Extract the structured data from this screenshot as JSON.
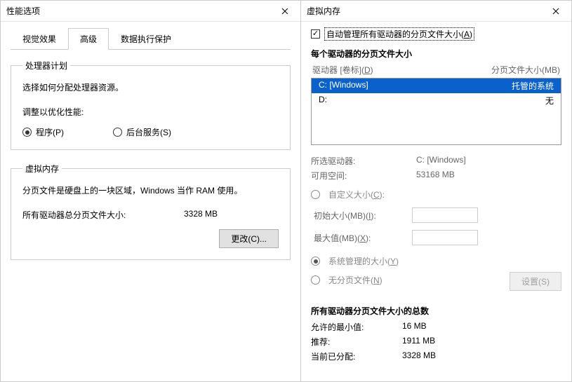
{
  "left": {
    "title": "性能选项",
    "tabs": {
      "visual": "视觉效果",
      "advanced": "高级",
      "dep": "数据执行保护"
    },
    "processor": {
      "legend": "处理器计划",
      "desc": "选择如何分配处理器资源。",
      "adjust_label": "调整以优化性能:",
      "radio_programs": "程序(P)",
      "radio_services": "后台服务(S)"
    },
    "vm": {
      "legend": "虚拟内存",
      "desc": "分页文件是硬盘上的一块区域，Windows 当作 RAM 使用。",
      "total_label": "所有驱动器总分页文件大小:",
      "total_value": "3328 MB",
      "change_btn": "更改(C)..."
    }
  },
  "right": {
    "title": "虚拟内存",
    "auto_manage_pre": "自动管理所有驱动器的分页文件大小(",
    "auto_manage_key": "A",
    "auto_manage_post": ")",
    "per_drive_heading": "每个驱动器的分页文件大小",
    "list_header_drive_pre": "驱动器 [卷标](",
    "list_header_drive_key": "D",
    "list_header_drive_post": ")",
    "list_header_size": "分页文件大小(MB)",
    "drives": [
      {
        "name": "C:      [Windows]",
        "size": "托管的系统",
        "selected": true
      },
      {
        "name": "D:",
        "size": "无",
        "selected": false
      }
    ],
    "selected_drive_label": "所选驱动器:",
    "selected_drive_value": "C:  [Windows]",
    "free_space_label": "可用空间:",
    "free_space_value": "53168 MB",
    "custom_size_pre": "自定义大小(",
    "custom_size_key": "C",
    "custom_size_post": "):",
    "initial_size_pre": "初始大小(MB)(",
    "initial_size_key": "I",
    "initial_size_post": "):",
    "max_size_pre": "最大值(MB)(",
    "max_size_key": "X",
    "max_size_post": "):",
    "sys_managed_pre": "系统管理的大小(",
    "sys_managed_key": "Y",
    "sys_managed_post": ")",
    "no_paging_pre": "无分页文件(",
    "no_paging_key": "N",
    "no_paging_post": ")",
    "set_btn": "设置(S)",
    "totals_heading": "所有驱动器分页文件大小的总数",
    "min_allowed_label": "允许的最小值:",
    "min_allowed_value": "16 MB",
    "recommended_label": "推荐:",
    "recommended_value": "1911 MB",
    "current_label": "当前已分配:",
    "current_value": "3328 MB"
  }
}
